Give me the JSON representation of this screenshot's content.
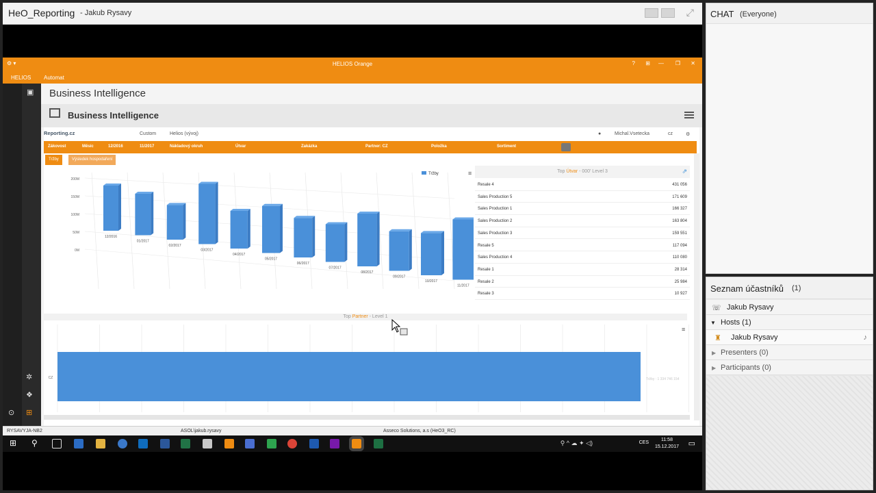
{
  "meeting": {
    "title": "HeO_Reporting",
    "presenter": "- Jakub Rysavy"
  },
  "helios": {
    "window_title": "HELIOS Orange",
    "menu": [
      "HELIOS",
      "Automat"
    ],
    "page_heading": "Business Intelligence",
    "bi_title": "Business Intelligence",
    "report_logo": "Reporting.cz",
    "report_menu": [
      "Custom",
      "Helios (vývoj)"
    ],
    "user": "Michal.Vsetecka",
    "lang": "cz",
    "filters": [
      "Zákovost",
      "Měsíc",
      "12/2016",
      "11/2017",
      "Nákladový okruh",
      "Útvar",
      "Zakázka",
      "Partner: CZ",
      "Položka",
      "Sortiment"
    ],
    "chips": [
      "Tržby",
      "Výsledek hospodaření"
    ],
    "statusbar": [
      "RYSAVYJA-NB2",
      "ASOL\\jakub.rysavy",
      "Asseco Solutions, a.s (HeO3_RC)"
    ],
    "taskbar": {
      "lang": "CES",
      "time": "11:58",
      "date": "15.12.2017"
    }
  },
  "top_table": {
    "title_prefix": "Top",
    "title_dim": "Útvar",
    "title_suffix": "- 000' Level 3",
    "rows": [
      {
        "name": "Resale 4",
        "value": "431 056"
      },
      {
        "name": "Sales Production 5",
        "value": "171 609"
      },
      {
        "name": "Sales Production 1",
        "value": "166 327"
      },
      {
        "name": "Sales Production 2",
        "value": "163 804"
      },
      {
        "name": "Sales Production 3",
        "value": "159 551"
      },
      {
        "name": "Resale 5",
        "value": "117 094"
      },
      {
        "name": "Sales Production 4",
        "value": "110 080"
      },
      {
        "name": "Resale 1",
        "value": "28 314"
      },
      {
        "name": "Resale 2",
        "value": "25 984"
      },
      {
        "name": "Resale 3",
        "value": "10 927"
      }
    ]
  },
  "partner_panel": {
    "title_prefix": "Top",
    "title_dim": "Partner",
    "title_suffix": "- Level 1",
    "category": "CZ",
    "tooltip": "Tržby : 1 334 746 154"
  },
  "chart_data": [
    {
      "type": "bar",
      "title": "",
      "legend": [
        "Tržby"
      ],
      "legend_position": "top-right",
      "categories": [
        "12/2016",
        "01/2017",
        "02/2017",
        "03/2017",
        "04/2017",
        "05/2017",
        "06/2017",
        "07/2017",
        "08/2017",
        "09/2017",
        "10/2017",
        "11/2017"
      ],
      "series": [
        {
          "name": "Tržby",
          "values": [
            120,
            110,
            92,
            160,
            100,
            125,
            105,
            100,
            140,
            105,
            112,
            160
          ]
        }
      ],
      "y_ticks": [
        "200M",
        "150M",
        "100M",
        "50M",
        "0M"
      ],
      "ylim": [
        0,
        200
      ],
      "grid": true
    },
    {
      "type": "bar",
      "orientation": "horizontal",
      "categories": [
        "CZ"
      ],
      "series": [
        {
          "name": "Tržby",
          "values": [
            1334746154
          ]
        }
      ]
    }
  ],
  "chat": {
    "title": "CHAT",
    "scope": "(Everyone)"
  },
  "participants": {
    "title": "Seznam účastníků",
    "count": "(1)",
    "me": "Jakub Rysavy",
    "groups": [
      {
        "label": "Hosts (1)",
        "expanded": true
      },
      {
        "label": "Presenters (0)",
        "expanded": false
      },
      {
        "label": "Participants (0)",
        "expanded": false
      }
    ],
    "host_name": "Jakub Rysavy"
  },
  "colors": {
    "accent": "#ef8c12",
    "bar": "#4a90d9"
  }
}
